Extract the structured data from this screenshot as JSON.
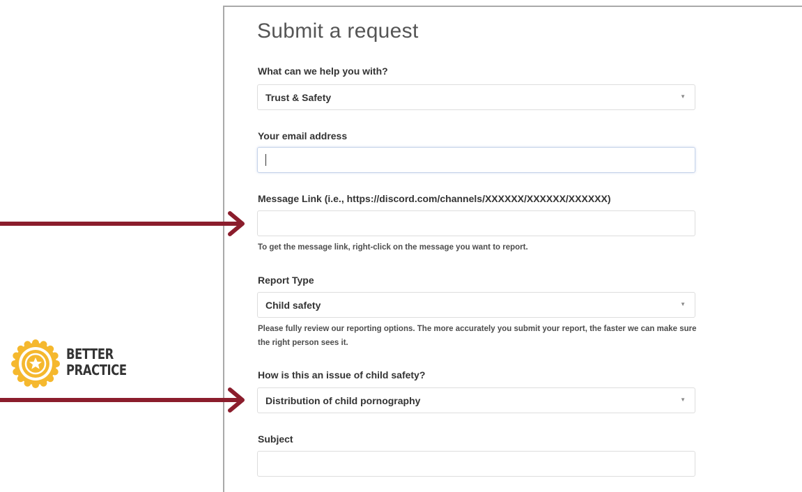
{
  "page": {
    "title": "Submit a request"
  },
  "form": {
    "help_topic": {
      "label": "What can we help you with?",
      "value": "Trust & Safety"
    },
    "email": {
      "label": "Your email address",
      "value": ""
    },
    "message_link": {
      "label": "Message Link (i.e., https://discord.com/channels/XXXXXX/XXXXXX/XXXXXX)",
      "value": "",
      "hint": "To get the message link, right-click on the message you want to report."
    },
    "report_type": {
      "label": "Report Type",
      "value": "Child safety",
      "hint": "Please fully review our reporting options. The more accurately you submit your report, the faster we can make sure the right person sees it."
    },
    "child_safety_issue": {
      "label": "How is this an issue of child safety?",
      "value": "Distribution of child pornography"
    },
    "subject": {
      "label": "Subject",
      "value": ""
    }
  },
  "annotation": {
    "badge_text_line1": "BETTER",
    "badge_text_line2": "PRACTICE",
    "badge_icon": "star-medal-icon",
    "arrow_color": "#8b1d2c",
    "badge_color": "#f5b82e"
  },
  "icons": {
    "dropdown_caret": "▼"
  }
}
